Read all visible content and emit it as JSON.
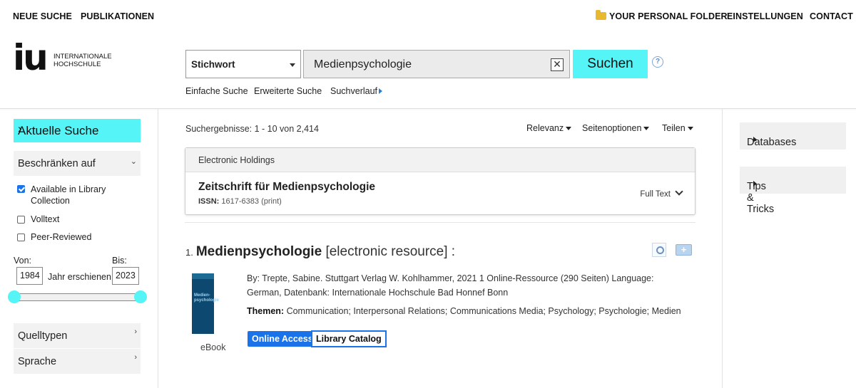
{
  "topnav": {
    "new_search": "NEUE SUCHE",
    "publications": "PUBLIKATIONEN",
    "folder": "YOUR PERSONAL FOLDER",
    "settings": "EINSTELLUNGEN",
    "contact": "CONTACT"
  },
  "logo": {
    "mark": "iu",
    "line1": "INTERNATIONALE",
    "line2": "HOCHSCHULE"
  },
  "search": {
    "type": "Stichwort",
    "query": "Medienpsychologie",
    "button": "Suchen",
    "help": "?",
    "links": [
      "Einfache Suche",
      "Erweiterte Suche",
      "Suchverlauf"
    ]
  },
  "sidebar": {
    "current_search": "Aktuelle Suche",
    "limit_to": "Beschränken auf",
    "facets": [
      {
        "label_line1": "Available in Library",
        "label_line2": "Collection",
        "checked": true
      },
      {
        "label": "Volltext",
        "checked": false
      },
      {
        "label": "Peer-Reviewed",
        "checked": false
      }
    ],
    "from_label": "Von:",
    "to_label": "Bis:",
    "from_year": "1984",
    "to_year": "2023",
    "year_caption": "Jahr erschienen",
    "source_types": "Quelltypen",
    "language": "Sprache"
  },
  "results": {
    "count": "Suchergebnisse: 1 - 10 von 2,414",
    "sort": "Relevanz",
    "page_options": "Seitenoptionen",
    "share": "Teilen"
  },
  "holdings": {
    "header": "Electronic Holdings",
    "journal": "Zeitschrift für Medienpsychologie",
    "issn_label": "ISSN:",
    "issn_value": "1617-6383 (print)",
    "full_text": "Full Text"
  },
  "record": {
    "number": "1.",
    "title": "Medienpsychologie",
    "type": "[electronic resource] :",
    "byline": "By: Trepte, Sabine. Stuttgart Verlag W. Kohlhammer, 2021 1 Online-Ressource (290 Seiten) Language: German, Datenbank: Internationale Hochschule Bad Honnef Bonn",
    "themes_label": "Themen:",
    "themes": "Communication; Interpersonal Relations; Communications Media; Psychology; Psychologie; Medien",
    "format": "eBook",
    "online_access": "Online Access",
    "library_catalog": "Library Catalog",
    "cover_title": "Medien-\npsychologie"
  },
  "right_sidebar": {
    "databases": "Databases",
    "tips": "Tips & Tricks"
  },
  "colors": {
    "accent_cyan": "#55f4f6",
    "link_blue": "#1a73e8"
  }
}
